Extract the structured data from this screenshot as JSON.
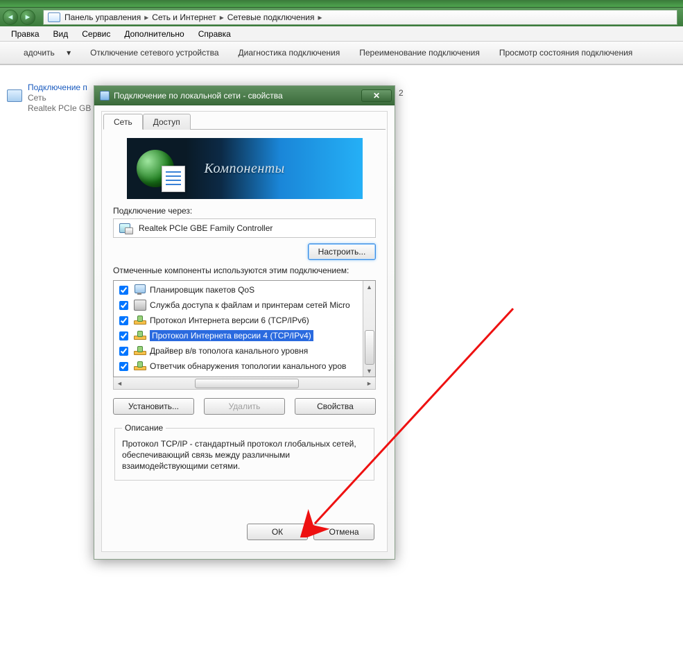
{
  "breadcrumbs": {
    "root": "Панель управления",
    "mid": "Сеть и Интернет",
    "leaf": "Сетевые подключения"
  },
  "menu": {
    "edit": "Правка",
    "view": "Вид",
    "service": "Сервис",
    "advanced": "Дополнительно",
    "help": "Справка"
  },
  "commands": {
    "organize": "адочить",
    "disable": "Отключение сетевого устройства",
    "diagnose": "Диагностика подключения",
    "rename": "Переименование подключения",
    "status": "Просмотр состояния подключения"
  },
  "connItem": {
    "title": "Подключение п",
    "type": "Сеть",
    "device": "Realtek PCIe GB"
  },
  "floatTwo": "2",
  "dialog": {
    "title": "Подключение по локальной сети - свойства",
    "tabs": {
      "network": "Сеть",
      "sharing": "Доступ"
    },
    "bannerLabel": "Компоненты",
    "connectUsing": "Подключение через:",
    "adapter": "Realtek PCIe GBE Family Controller",
    "configure": "Настроить...",
    "componentsLabel": "Отмеченные компоненты используются этим подключением:",
    "list": {
      "i0": "Планировщик пакетов QoS",
      "i1": "Служба доступа к файлам и принтерам сетей Micro",
      "i2": "Протокол Интернета версии 6 (TCP/IPv6)",
      "i3": "Протокол Интернета версии 4 (TCP/IPv4)",
      "i4": "Драйвер в/в тополога канального уровня",
      "i5": "Ответчик обнаружения топологии канального уров"
    },
    "install": "Установить...",
    "remove": "Удалить",
    "properties": "Свойства",
    "descLegend": "Описание",
    "descText": "Протокол TCP/IP - стандартный протокол глобальных сетей, обеспечивающий связь между различными взаимодействующими сетями.",
    "ok": "ОК",
    "cancel": "Отмена"
  }
}
